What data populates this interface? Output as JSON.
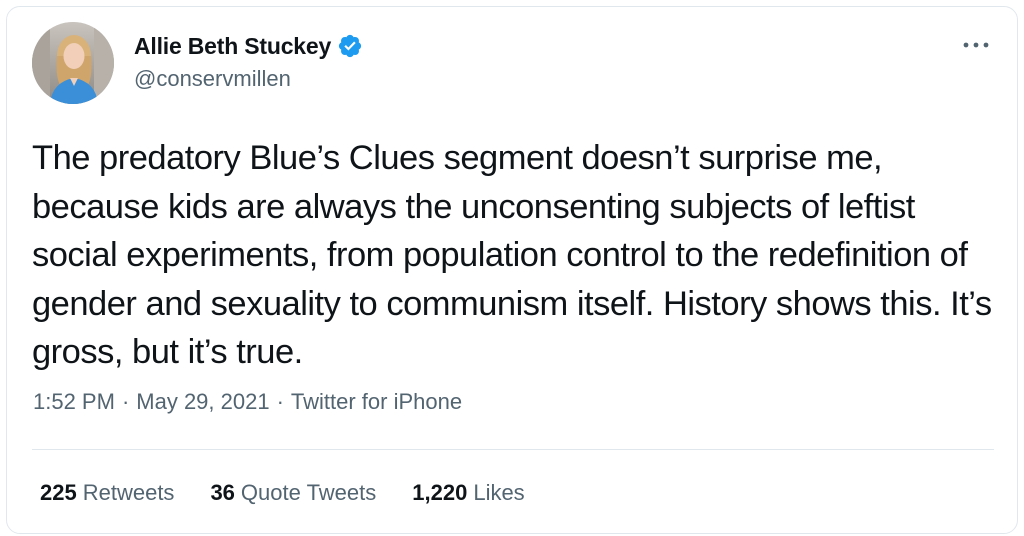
{
  "author": {
    "display_name": "Allie Beth Stuckey",
    "handle": "@conservmillen",
    "verified": true
  },
  "tweet": {
    "text": "The predatory Blue’s Clues segment doesn’t surprise me, because kids are always the unconsenting subjects of leftist social experiments, from population control to the redefinition of gender and sexuality to communism itself. History shows this. It’s gross, but it’s true.",
    "time": "1:52 PM",
    "date": "May 29, 2021",
    "source": "Twitter for iPhone",
    "separator": "·"
  },
  "stats": {
    "retweets": {
      "count": "225",
      "label": "Retweets"
    },
    "quotes": {
      "count": "36",
      "label": "Quote Tweets"
    },
    "likes": {
      "count": "1,220",
      "label": "Likes"
    }
  },
  "colors": {
    "text_primary": "#0f1419",
    "text_secondary": "#536471",
    "verified_blue": "#1d9bf0",
    "border": "#e1e8ed"
  },
  "icons": {
    "verified": "verified-badge-icon",
    "more": "more-options-icon"
  }
}
